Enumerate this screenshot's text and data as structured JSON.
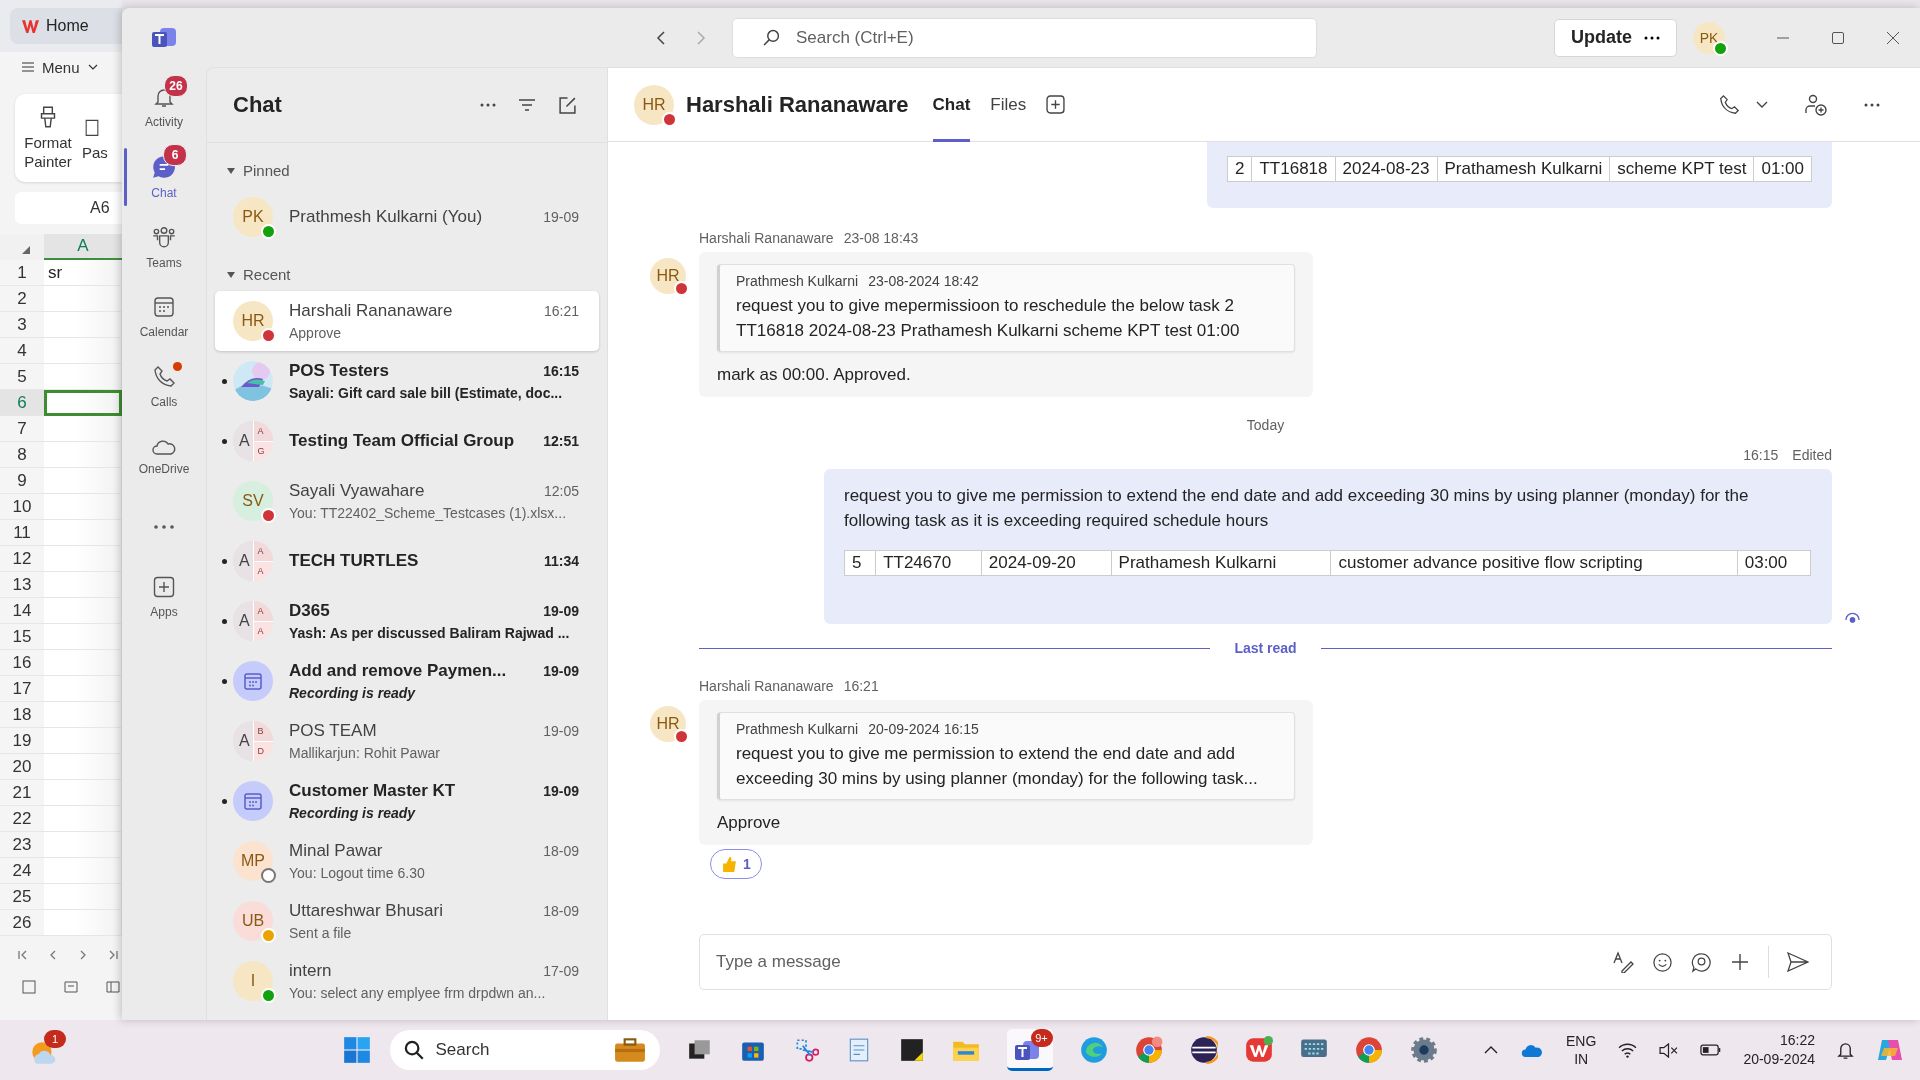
{
  "spreadsheet": {
    "tab": "Home",
    "menu": "Menu",
    "ribbon": [
      "Format Painter",
      "Pas"
    ],
    "name_box": "A6",
    "column": "A",
    "rows": [
      {
        "number": "1",
        "value": "sr",
        "selected": false
      },
      {
        "number": "2",
        "selected": false
      },
      {
        "number": "3",
        "selected": false
      },
      {
        "number": "4",
        "selected": false
      },
      {
        "number": "5",
        "selected": false
      },
      {
        "number": "6",
        "selected": true
      },
      {
        "number": "7",
        "selected": false
      },
      {
        "number": "8",
        "selected": false
      },
      {
        "number": "9",
        "selected": false
      },
      {
        "number": "10",
        "selected": false
      },
      {
        "number": "11",
        "selected": false
      },
      {
        "number": "12",
        "selected": false
      },
      {
        "number": "13",
        "selected": false
      },
      {
        "number": "14",
        "selected": false
      },
      {
        "number": "15",
        "selected": false
      },
      {
        "number": "16",
        "selected": false
      },
      {
        "number": "17",
        "selected": false
      },
      {
        "number": "18",
        "selected": false
      },
      {
        "number": "19",
        "selected": false
      },
      {
        "number": "20",
        "selected": false
      },
      {
        "number": "21",
        "selected": false
      },
      {
        "number": "22",
        "selected": false
      },
      {
        "number": "23",
        "selected": false
      },
      {
        "number": "24",
        "selected": false
      },
      {
        "number": "25",
        "selected": false
      },
      {
        "number": "26",
        "selected": false
      }
    ]
  },
  "title_bar": {
    "search": {
      "placeholder": "Search (Ctrl+E)"
    },
    "update_button": "Update",
    "profile": {
      "initials": "PK",
      "status": {
        "kind": "available"
      }
    }
  },
  "rail": [
    {
      "kind": "bell",
      "label": "Activity",
      "badge": "26",
      "dot": false,
      "selected": false
    },
    {
      "kind": "chat",
      "label": "Chat",
      "badge": "6",
      "dot": false,
      "selected": true
    },
    {
      "kind": "people",
      "label": "Teams",
      "dot": false,
      "selected": false
    },
    {
      "kind": "calendar",
      "label": "Calendar",
      "dot": false,
      "selected": false
    },
    {
      "kind": "phone",
      "label": "Calls",
      "dot": true,
      "selected": false
    },
    {
      "kind": "cloud",
      "label": "OneDrive",
      "dot": false,
      "selected": false
    },
    {
      "kind": "more",
      "dot": false,
      "selected": false
    },
    {
      "kind": "apps",
      "label": "Apps",
      "dot": false,
      "selected": false
    }
  ],
  "chat_list": {
    "title": "Chat",
    "sections": [
      {
        "label": "Pinned",
        "items": [
          {
            "kind": "initials",
            "initials": "PK",
            "color": "#f7e6c4",
            "name": "Prathmesh Kulkarni (You)",
            "time": "19-09",
            "status": {
              "kind": "available"
            },
            "unread": false,
            "selected": false
          }
        ]
      },
      {
        "label": "Recent",
        "items": [
          {
            "kind": "initials",
            "initials": "HR",
            "color": "#f7e6c4",
            "name": "Harshali Rananaware",
            "time": "16:21",
            "preview": "Approve",
            "status": {
              "kind": "busy"
            },
            "unread": false,
            "selected": true
          },
          {
            "kind": "picture",
            "name": "POS Testers",
            "time": "16:15",
            "preview": "Sayali: Gift card sale bill (Estimate, doc...",
            "unread": true,
            "selected": false
          },
          {
            "kind": "group",
            "letters": [
              "A",
              "A",
              "G"
            ],
            "name": "Testing Team Official Group",
            "time": "12:51",
            "unread": true,
            "selected": false
          },
          {
            "kind": "initials",
            "initials": "SV",
            "color": "#d6efdf",
            "name": "Sayali Vyawahare",
            "time": "12:05",
            "preview": "You: TT22402_Scheme_Testcases (1).xlsx...",
            "status": {
              "kind": "busy"
            },
            "unread": false,
            "selected": false
          },
          {
            "kind": "group",
            "letters": [
              "A",
              "A",
              "A"
            ],
            "name": "TECH TURTLES",
            "time": "11:34",
            "unread": true,
            "selected": false
          },
          {
            "kind": "group",
            "letters": [
              "A",
              "A",
              "A"
            ],
            "name": "D365",
            "time": "19-09",
            "preview": "Yash: As per discussed Baliram Rajwad ...",
            "unread": true,
            "selected": false
          },
          {
            "kind": "meeting",
            "name": "Add and remove Paymen...",
            "time": "19-09",
            "preview": "Recording is ready",
            "unread": true,
            "selected": false
          },
          {
            "kind": "group",
            "letters": [
              "A",
              "B",
              "D"
            ],
            "name": "POS TEAM",
            "time": "19-09",
            "preview": "Mallikarjun: Rohit Pawar",
            "unread": false,
            "selected": false
          },
          {
            "kind": "meeting",
            "name": "Customer Master KT",
            "time": "19-09",
            "preview": "Recording is ready",
            "unread": true,
            "selected": false
          },
          {
            "kind": "initials",
            "initials": "MP",
            "color": "#fbe3cf",
            "name": "Minal Pawar",
            "time": "18-09",
            "preview": "You: Logout time 6.30",
            "status": {
              "kind": "offline"
            },
            "unread": false,
            "selected": false
          },
          {
            "kind": "initials",
            "initials": "UB",
            "color": "#fadcd9",
            "name": "Uttareshwar Bhusari",
            "time": "18-09",
            "preview": "Sent a file",
            "status": {
              "kind": "away"
            },
            "unread": false,
            "selected": false
          },
          {
            "kind": "initials",
            "initials": "I",
            "color": "#f7e6c4",
            "name": "intern",
            "time": "17-09",
            "preview": "You: select any emplyee frm drpdwn an...",
            "status": {
              "kind": "available"
            },
            "unread": false,
            "selected": false
          }
        ]
      }
    ]
  },
  "conversation": {
    "initials": "HR",
    "status": {
      "kind": "busy"
    },
    "name": "Harshali Rananaware",
    "tabs": [
      {
        "label": "Chat",
        "selected": true
      },
      {
        "label": "Files",
        "selected": false
      }
    ],
    "messages": [
      {
        "kind": "own",
        "table": [
          "2",
          "TT16818",
          "2024-08-23",
          "Prathamesh Kulkarni",
          "scheme KPT test",
          "01:00"
        ]
      },
      {
        "kind": "incoming",
        "initials": "HR",
        "status": {
          "kind": "busy"
        },
        "sender": "Harshali Rananaware",
        "time": "23-08 18:43",
        "quote": {
          "author": "Prathmesh Kulkarni",
          "time": "23-08-2024 18:42",
          "text": "request you to give mepermissioon to reschedule the below task 2 TT16818 2024-08-23 Prathamesh Kulkarni scheme KPT test 01:00"
        },
        "text": "mark as 00:00. Approved."
      },
      {
        "kind": "divider",
        "text": "Today"
      },
      {
        "kind": "own",
        "time": "16:15",
        "edited": "Edited",
        "text": "request you to give me permission to extend the end date and add exceeding 30 mins by using planner (monday) for the following task as it is exceeding required schedule hours",
        "table": [
          "5",
          "TT24670",
          "2024-09-20",
          "Prathamesh Kulkarni",
          "customer advance positive flow scripting",
          "03:00"
        ],
        "seen": true
      },
      {
        "kind": "last_read",
        "text": "Last read"
      },
      {
        "kind": "incoming",
        "initials": "HR",
        "status": {
          "kind": "busy"
        },
        "sender": "Harshali Rananaware",
        "time": "16:21",
        "quote": {
          "author": "Prathmesh Kulkarni",
          "time": "20-09-2024 16:15",
          "text": "request you to give me permission to extend the end date and add exceeding 30 mins by using planner (monday) for the following task..."
        },
        "text": "Approve",
        "reaction": "1"
      }
    ],
    "compose": {
      "placeholder": "Type a message"
    }
  },
  "taskbar": {
    "weather_badge": "1",
    "search": {
      "placeholder": "Search"
    },
    "teams_badge": "9+",
    "language": "ENG",
    "region": "IN",
    "time": "16:22",
    "date": "20-09-2024"
  }
}
